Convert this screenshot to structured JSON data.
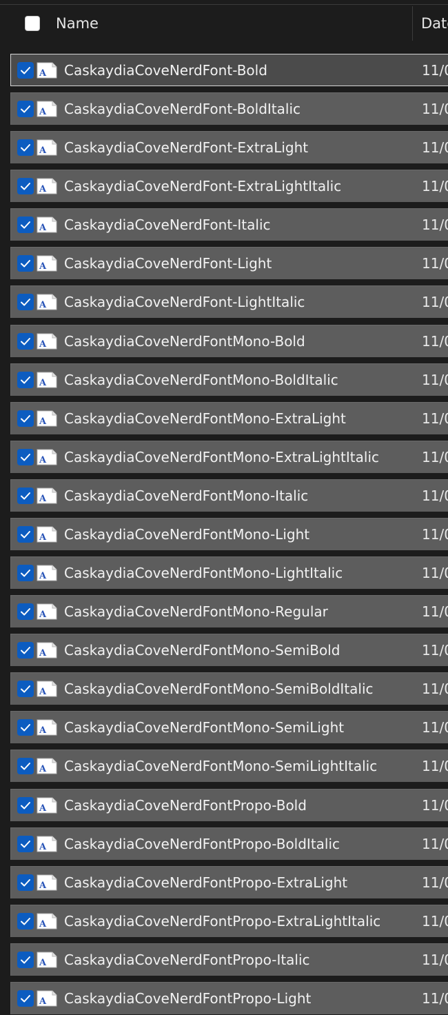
{
  "header": {
    "name_label": "Name",
    "date_label": "Date"
  },
  "icons": {
    "row_checkbox": "checkmark-icon",
    "file": "font-file-icon"
  },
  "colors": {
    "checkbox_accent": "#0c5cc0",
    "row_background": "#5d5d5d",
    "window_background": "#1c1c1c"
  },
  "files": [
    {
      "name": "CaskaydiaCoveNerdFont-Bold",
      "date": "11/0",
      "selected": true
    },
    {
      "name": "CaskaydiaCoveNerdFont-BoldItalic",
      "date": "11/0",
      "selected": true
    },
    {
      "name": "CaskaydiaCoveNerdFont-ExtraLight",
      "date": "11/0",
      "selected": true
    },
    {
      "name": "CaskaydiaCoveNerdFont-ExtraLightItalic",
      "date": "11/0",
      "selected": true
    },
    {
      "name": "CaskaydiaCoveNerdFont-Italic",
      "date": "11/0",
      "selected": true
    },
    {
      "name": "CaskaydiaCoveNerdFont-Light",
      "date": "11/0",
      "selected": true
    },
    {
      "name": "CaskaydiaCoveNerdFont-LightItalic",
      "date": "11/0",
      "selected": true
    },
    {
      "name": "CaskaydiaCoveNerdFontMono-Bold",
      "date": "11/0",
      "selected": true
    },
    {
      "name": "CaskaydiaCoveNerdFontMono-BoldItalic",
      "date": "11/0",
      "selected": true
    },
    {
      "name": "CaskaydiaCoveNerdFontMono-ExtraLight",
      "date": "11/0",
      "selected": true
    },
    {
      "name": "CaskaydiaCoveNerdFontMono-ExtraLightItalic",
      "date": "11/0",
      "selected": true
    },
    {
      "name": "CaskaydiaCoveNerdFontMono-Italic",
      "date": "11/0",
      "selected": true
    },
    {
      "name": "CaskaydiaCoveNerdFontMono-Light",
      "date": "11/0",
      "selected": true
    },
    {
      "name": "CaskaydiaCoveNerdFontMono-LightItalic",
      "date": "11/0",
      "selected": true
    },
    {
      "name": "CaskaydiaCoveNerdFontMono-Regular",
      "date": "11/0",
      "selected": true
    },
    {
      "name": "CaskaydiaCoveNerdFontMono-SemiBold",
      "date": "11/0",
      "selected": true
    },
    {
      "name": "CaskaydiaCoveNerdFontMono-SemiBoldItalic",
      "date": "11/0",
      "selected": true
    },
    {
      "name": "CaskaydiaCoveNerdFontMono-SemiLight",
      "date": "11/0",
      "selected": true
    },
    {
      "name": "CaskaydiaCoveNerdFontMono-SemiLightItalic",
      "date": "11/0",
      "selected": true
    },
    {
      "name": "CaskaydiaCoveNerdFontPropo-Bold",
      "date": "11/0",
      "selected": true
    },
    {
      "name": "CaskaydiaCoveNerdFontPropo-BoldItalic",
      "date": "11/0",
      "selected": true
    },
    {
      "name": "CaskaydiaCoveNerdFontPropo-ExtraLight",
      "date": "11/0",
      "selected": true
    },
    {
      "name": "CaskaydiaCoveNerdFontPropo-ExtraLightItalic",
      "date": "11/0",
      "selected": true
    },
    {
      "name": "CaskaydiaCoveNerdFontPropo-Italic",
      "date": "11/0",
      "selected": true
    },
    {
      "name": "CaskaydiaCoveNerdFontPropo-Light",
      "date": "11/0",
      "selected": true
    }
  ]
}
